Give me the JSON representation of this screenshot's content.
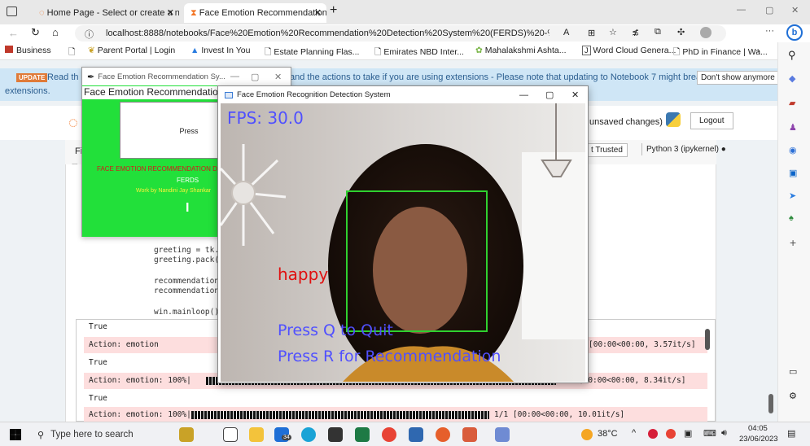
{
  "browser": {
    "tabs": [
      {
        "title": "Home Page - Select or create a n"
      },
      {
        "title": "Face Emotion Recommendation"
      }
    ],
    "address": "localhost:8888/notebooks/Face%20Emotion%20Recommendation%20Detection%20System%20(FERDS)%20-%20Final%20...",
    "favorites": [
      "Business",
      "Parent Portal | Login",
      "Invest In You",
      "Estate Planning Flas...",
      "Emirates NBD Inter...",
      "Mahalakshmi Ashta...",
      "Word Cloud Genera...",
      "PhD in Finance | Wa..."
    ]
  },
  "jupyter": {
    "banner_badge": "UPDATE",
    "banner_text_left": "Read th",
    "banner_text_right": "and the actions to take if you are using extensions - Please note that updating to Notebook 7 might break some of your",
    "banner_text_line2": "extensions.",
    "dont_show": "Don't show anymore",
    "unsaved": "unsaved changes)",
    "logout": "Logout",
    "trusted": "t Trusted",
    "kernel": "Python 3 (ipykernel)",
    "menu_first": "Fi",
    "code_lines": [
      "greeting = tk.L",
      "greeting.pack()",
      "recommendation_",
      "recommendation_",
      "win.mainloop()"
    ],
    "outputs": [
      {
        "text": "True",
        "err": false
      },
      {
        "text": "Action: emotion",
        "tail": "[00:00<00:00,  3.57it/s]",
        "err": true
      },
      {
        "text": "True",
        "err": false
      },
      {
        "text": "Action: emotion: 100%|",
        "tail": "1/1 [00:00<00:00,  8.34it/s]",
        "err": true
      },
      {
        "text": "True",
        "err": false
      },
      {
        "text": "Action: emotion: 100%|",
        "tail": "1/1 [00:00<00:00, 10.01it/s]",
        "err": true
      }
    ]
  },
  "tk_window": {
    "title": "Face Emotion Recommendation Sy...",
    "label": "Face Emotion Recommendation D",
    "press": "Press",
    "heading": "FACE EMOTION RECOMMENDATION D",
    "abbr": "FERDS",
    "subtitle": "Work by Nandini Jay Shankar",
    "btn_text": "I"
  },
  "cv_window": {
    "title": "Face Emotion Recognition Detection System",
    "fps": "FPS: 30.0",
    "emotion": "happy",
    "quit_hint": "Press Q to Quit",
    "rec_hint": "Press R for Recommendation"
  },
  "taskbar": {
    "search": "Type here to search",
    "badge": "34",
    "weather": "38°C",
    "time": "04:05",
    "date": "23/06/2023"
  },
  "colors": {
    "tk_green": "#22e03a",
    "cv_fps": "#5050ff",
    "cv_emotion": "#e01010",
    "face_box": "#2fd02f"
  }
}
